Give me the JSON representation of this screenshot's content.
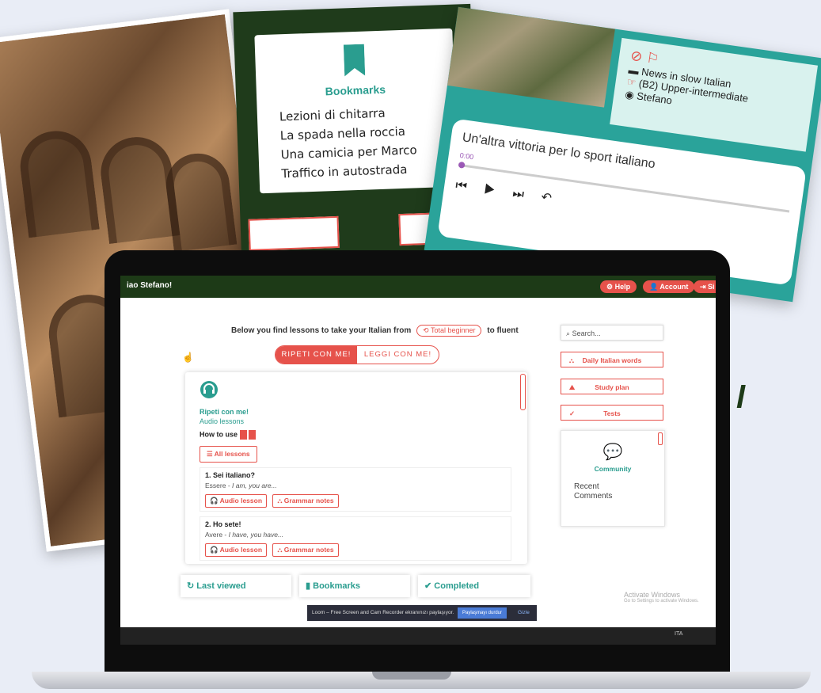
{
  "bookmarks_card": {
    "title": "Bookmarks",
    "items": [
      "Lezioni di chitarra",
      "La spada nella roccia",
      "Una camicia per Marco",
      "Traffico in autostrada"
    ]
  },
  "news_card": {
    "category": "News in slow Italian",
    "level": "(B2) Upper-intermediate",
    "author": "Stefano",
    "title": "Un'altra vittoria per lo sport italiano",
    "time": "0:00"
  },
  "app": {
    "greeting": "iao Stefano!",
    "header_buttons": [
      "Help",
      "Account",
      "Si"
    ],
    "intro_before": "Below you find lessons to take your Italian from",
    "intro_level": "Total beginner",
    "intro_after": "to fluent",
    "tabs": {
      "active": "RIPETI CON ME!",
      "inactive": "LEGGI CON ME!"
    },
    "panel": {
      "title": "Ripeti con me!",
      "subtitle": "Audio lessons",
      "how_to": "How to use",
      "all_lessons": "All lessons",
      "lessons": [
        {
          "title": "1. Sei italiano?",
          "verb": "Essere - ",
          "meaning": "I am, you are..."
        },
        {
          "title": "2. Ho sete!",
          "verb": "Avere - ",
          "meaning": "I have, you have..."
        }
      ],
      "audio_btn": "Audio lesson",
      "grammar_btn": "Grammar notes"
    },
    "sidebar": {
      "search_placeholder": "Search...",
      "daily_words": "Daily Italian words",
      "study_plan": "Study plan",
      "tests": "Tests",
      "community": "Community",
      "recent_comments": "Recent Comments"
    },
    "bottom": [
      "Last viewed",
      "Bookmarks",
      "Completed"
    ],
    "loom_text": "Loom – Free Screen and Cam Recorder ekranınızı paylaşıyor.",
    "loom_stop": "Paylaşmayı durdur",
    "loom_hide": "Gizle",
    "activate_title": "Activate Windows",
    "activate_sub": "Go to Settings to activate Windows.",
    "tray_lang": "ITA"
  },
  "colors": {
    "accent": "#e6524b",
    "teal": "#2a9d8f",
    "dark_green": "#1d3a17"
  }
}
